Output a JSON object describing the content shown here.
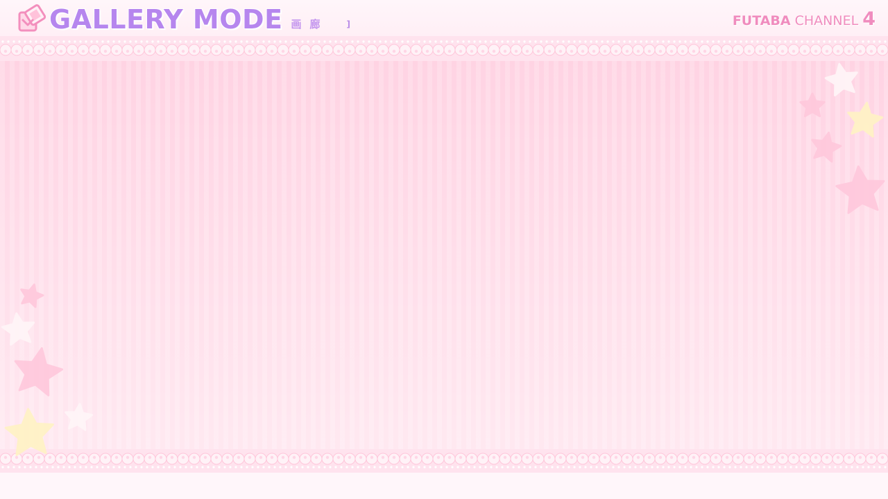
{
  "header": {
    "title": "GALLERY MODE",
    "subtitle_open": "[",
    "subtitle_text": "画廊",
    "subtitle_close": "]",
    "icon": "gallery-frame-icon"
  },
  "brand": {
    "bold": "FUTABA",
    "light": "CHANNEL",
    "number": "4"
  },
  "colors": {
    "title": "#b686ee",
    "brand": "#f08cbe",
    "background_top": "#ffd3e3",
    "background_bottom": "#ffe9f1",
    "star_pink": "#ffc8dc",
    "star_yellow": "#fff3c4",
    "star_white": "#fff6f8"
  },
  "decorations": [
    "star-icon",
    "lace-border"
  ]
}
